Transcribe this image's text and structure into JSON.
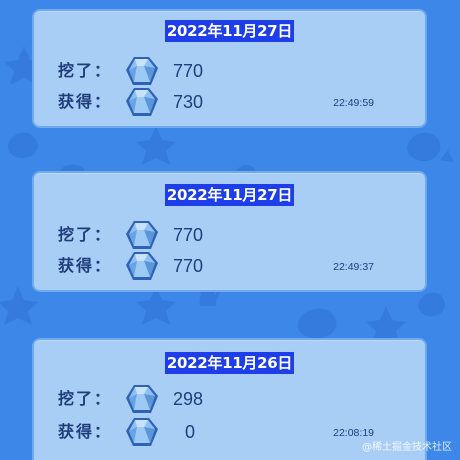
{
  "records": [
    {
      "date": "2022年11月27日",
      "dig_label": "挖了：",
      "dig_value": "770",
      "get_label": "获得：",
      "get_value": "730",
      "time": "22:49:59"
    },
    {
      "date": "2022年11月27日",
      "dig_label": "挖了：",
      "dig_value": "770",
      "get_label": "获得：",
      "get_value": "770",
      "time": "22:49:37"
    },
    {
      "date": "2022年11月26日",
      "dig_label": "挖了：",
      "dig_value": "298",
      "get_label": "获得：",
      "get_value": "0",
      "time": "22:08:19"
    }
  ],
  "watermark": "@稀土掘金技术社区",
  "colors": {
    "background": "#3d87e8",
    "card": "#a9cef6",
    "card_border": "#6fa9ef",
    "date_highlight": "#1d3ee8",
    "text": "#1e3f7c",
    "gem": "#6fa8e6"
  },
  "icons": {
    "gem": "ore-gem-icon"
  }
}
